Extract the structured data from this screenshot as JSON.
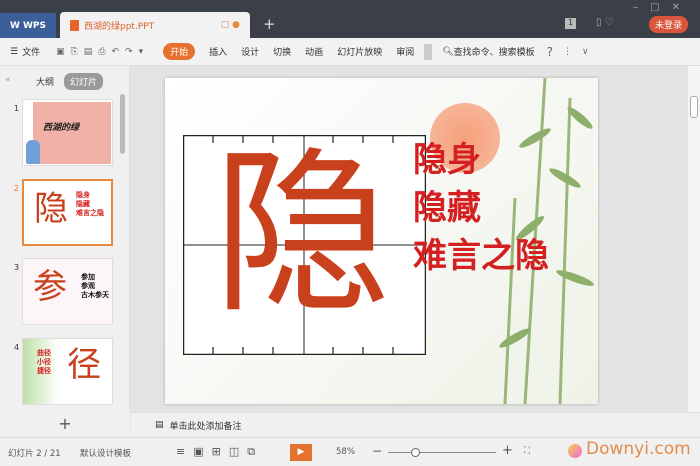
{
  "titlebar": {
    "app_tab": "WPS",
    "doc_tab": "西湖的绿ppt.PPT",
    "login": "未登录"
  },
  "toolbar": {
    "file": "文件",
    "tabs": [
      "开始",
      "插入",
      "设计",
      "切换",
      "动画",
      "幻灯片放映",
      "审阅"
    ],
    "active_tab": "开始",
    "search": "查找命令、搜索模板"
  },
  "left_panel": {
    "tabs": [
      "大纲",
      "幻灯片"
    ],
    "active_tab": "幻灯片",
    "slides": [
      {
        "num": "1",
        "text": "西湖的绿"
      },
      {
        "num": "2",
        "big": "隐",
        "lines": [
          "隐身",
          "隐藏",
          "难言之隐"
        ]
      },
      {
        "num": "3",
        "big": "参",
        "lines": [
          "参加",
          "参观",
          "古木参天"
        ]
      },
      {
        "num": "4",
        "big": "径",
        "lines": [
          "曲径",
          "小径",
          "捷径"
        ]
      }
    ],
    "selected": 2
  },
  "slide": {
    "big_char": "隐",
    "lines": [
      "隐身",
      "隐藏",
      "难言之隐"
    ]
  },
  "notes": {
    "placeholder": "单击此处添加备注"
  },
  "status": {
    "slide_counter": "幻灯片 2 / 21",
    "template": "默认设计模板",
    "zoom": "58%",
    "zoom_fraction": 0.25,
    "watermark": "Downyi.com"
  },
  "colors": {
    "accent": "#e5722e",
    "big_char": "#c8401c",
    "text_red": "#d42020"
  }
}
